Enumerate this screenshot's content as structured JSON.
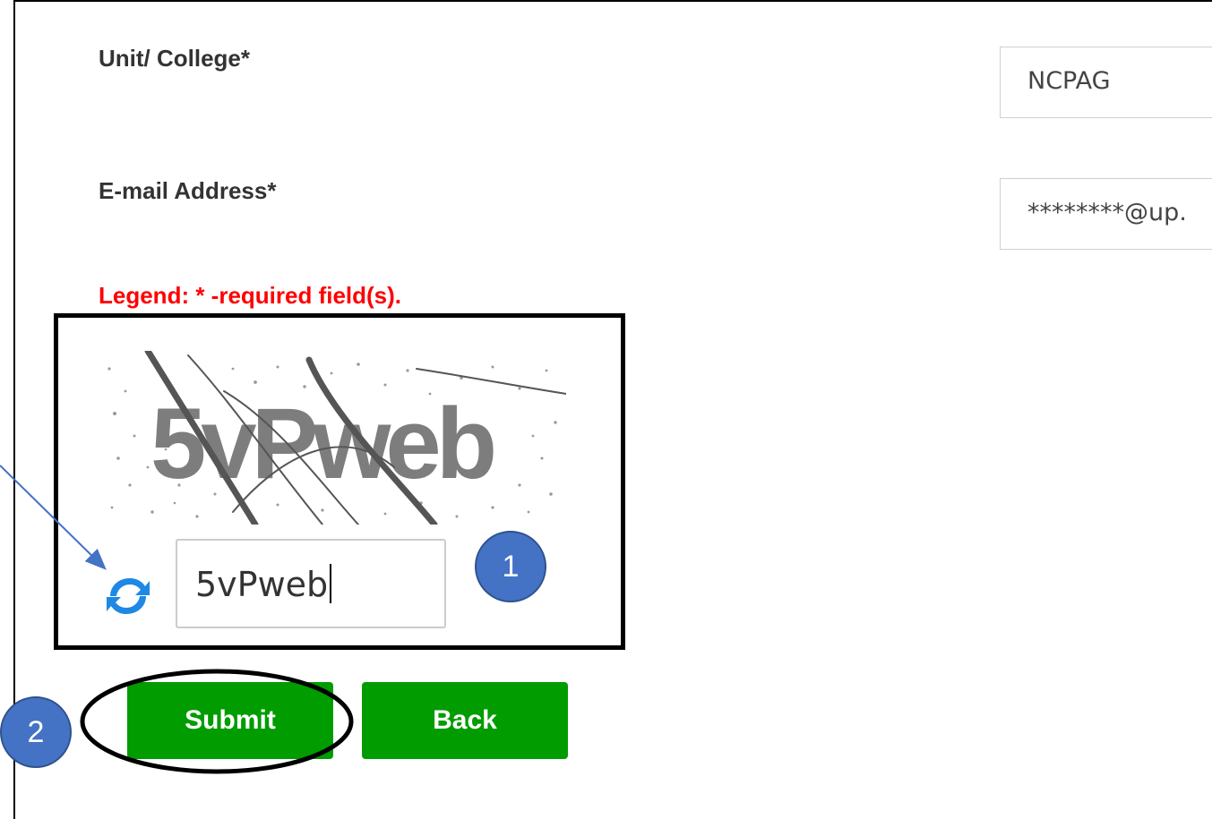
{
  "form": {
    "unit_college_label": "Unit/ College*",
    "unit_college_value": "NCPAG",
    "email_label": "E-mail Address*",
    "email_value": "********@up.",
    "legend": "Legend: * -required field(s).",
    "captcha_image_text": "5vPweb",
    "captcha_input_value": "5vPweb"
  },
  "buttons": {
    "submit_label": "Submit",
    "back_label": "Back"
  },
  "annotations": {
    "badge_1": "1",
    "badge_2": "2"
  },
  "icons": {
    "refresh": "refresh-icon"
  },
  "colors": {
    "button_green": "#009c00",
    "legend_red": "#ff0000",
    "badge_blue": "#4472c4",
    "refresh_blue": "#1e88e5"
  }
}
